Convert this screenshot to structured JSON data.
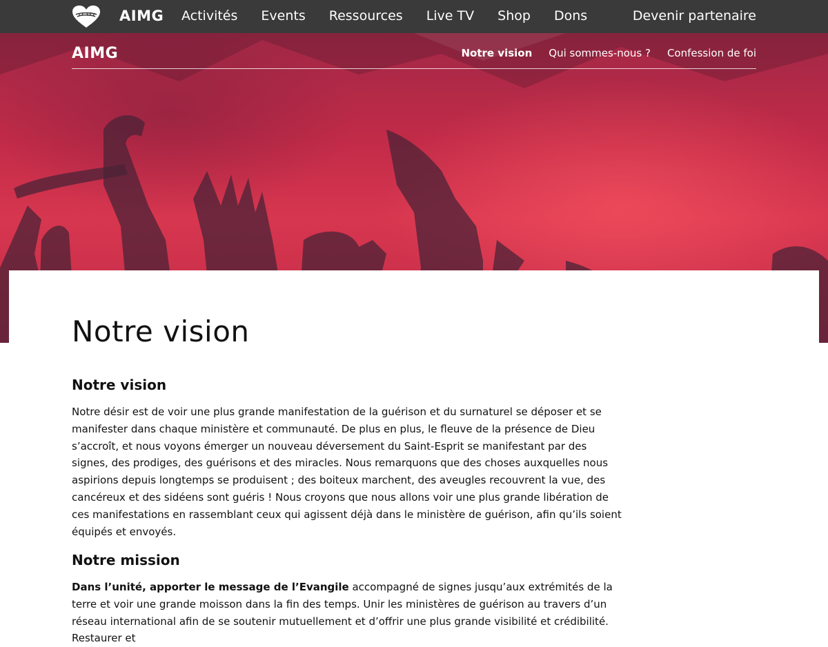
{
  "topnav": {
    "brand": "AIMG",
    "menu": [
      {
        "label": "Activités"
      },
      {
        "label": "Events"
      },
      {
        "label": "Ressources"
      },
      {
        "label": "Live TV"
      },
      {
        "label": "Shop"
      },
      {
        "label": "Dons"
      }
    ],
    "partner": "Devenir partenaire"
  },
  "subnav": {
    "brand": "AIMG",
    "items": [
      {
        "label": "Notre vision",
        "active": true
      },
      {
        "label": "Qui sommes-nous ?"
      },
      {
        "label": "Confession de foi"
      }
    ]
  },
  "main": {
    "title": "Notre vision",
    "sections": [
      {
        "heading": "Notre vision",
        "text": "Notre désir est de voir une plus grande manifestation de la guérison et du surnaturel se déposer et se manifester dans chaque ministère et communauté. De plus en plus, le fleuve de la présence de Dieu s’accroît, et nous voyons émerger un nouveau déversement du Saint-Esprit se manifestant par des signes, des prodiges, des guérisons et des miracles. Nous remarquons que des choses auxquelles nous aspirions depuis longtemps se produisent ; des boiteux marchent, des aveugles recouvrent la vue, des cancéreux et des sidéens sont guéris ! Nous croyons que nous allons voir une plus grande libération de ces manifestations en rassemblant ceux qui agissent déjà dans le ministère de guérison, afin qu’ils soient équipés et envoyés."
      },
      {
        "heading": "Notre mission",
        "text_bold": "Dans l’unité, apporter le message de l’Evangile",
        "text": " accompagné de signes jusqu’aux extrémités de la terre et voir une grande moisson dans la fin des temps. Unir les ministères de guérison au travers d’un réseau international afin de se soutenir mutuellement et d’offrir une plus grande visibilité et crédibilité. Restaurer et"
      }
    ]
  },
  "colors": {
    "topnav_bg": "#3a3a3a",
    "hero_red": "#c22b48",
    "text": "#111111"
  },
  "icons": {
    "logo": "heart-crown-of-thorns-logo"
  }
}
